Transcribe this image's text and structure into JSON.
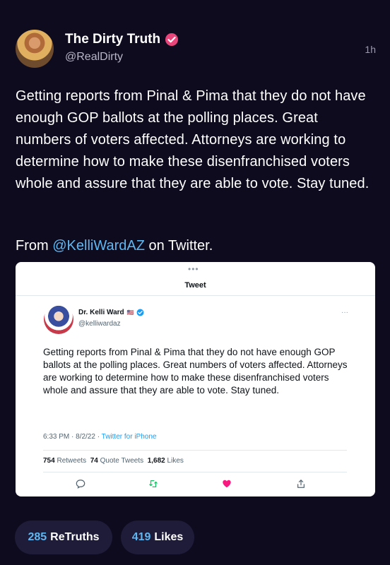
{
  "post": {
    "author_name": "The Dirty Truth",
    "author_handle": "@RealDirty",
    "time": "1h",
    "text": "Getting reports from Pinal & Pima that they do not have enough GOP ballots at the polling places. Great numbers of voters affected. Attorneys are working to determine how to make these disenfranchised voters whole and assure that they are able to vote. Stay tuned.",
    "from_prefix": "From",
    "from_mention": "@KelliWardAZ",
    "from_suffix": "on Twitter."
  },
  "embed": {
    "dots": "•••",
    "title": "Tweet",
    "author_name": "Dr. Kelli Ward",
    "flag": "🇺🇸",
    "author_handle": "@kelliwardaz",
    "more": "···",
    "text": "Getting reports from Pinal & Pima that they do not have enough GOP ballots at the polling places. Great numbers of voters affected. Attorneys are working to determine how to make these disenfranchised voters whole and assure that they are able to vote. Stay tuned.",
    "timestamp": "6:33 PM · 8/2/22 ·",
    "source": "Twitter for iPhone",
    "retweets_count": "754",
    "retweets_label": "Retweets",
    "quote_count": "74",
    "quote_label": "Quote Tweets",
    "likes_count": "1,682",
    "likes_label": "Likes",
    "icons": [
      "reply-icon",
      "retweet-icon",
      "heart-icon",
      "share-icon"
    ]
  },
  "footer": {
    "retruths_count": "285",
    "retruths_label": "ReTruths",
    "likes_count": "419",
    "likes_label": "Likes"
  },
  "colors": {
    "background": "#0e0b1f",
    "accent": "#5fb7f2",
    "verified": "#e8457a",
    "twitter_blue": "#1d9bf0",
    "heart": "#f91880"
  }
}
